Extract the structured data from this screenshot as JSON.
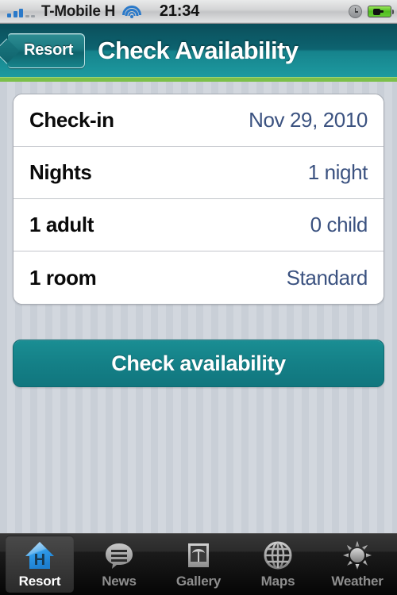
{
  "statusbar": {
    "carrier": "T-Mobile H",
    "time": "21:34",
    "signal_icon": "signal-bars-icon",
    "wifi_icon": "wifi-icon",
    "alarm_icon": "alarm-clock-icon",
    "battery_icon": "battery-charging-icon",
    "signal_bars_filled": 3,
    "signal_bars_total": 5
  },
  "navbar": {
    "back_label": "Resort",
    "title": "Check Availability",
    "accent_color": "#7cbf4a",
    "background_color": "#0d6370"
  },
  "form": {
    "rows": [
      {
        "label": "Check-in",
        "value": "Nov 29, 2010"
      },
      {
        "label": "Nights",
        "value": "1 night"
      },
      {
        "label": "1 adult",
        "value": "0 child"
      },
      {
        "label": "1 room",
        "value": "Standard"
      }
    ]
  },
  "action": {
    "check_label": "Check availability",
    "color": "#148087"
  },
  "tabbar": {
    "tabs": [
      {
        "label": "Resort",
        "icon": "house-icon",
        "active": true
      },
      {
        "label": "News",
        "icon": "speech-bubble-icon",
        "active": false
      },
      {
        "label": "Gallery",
        "icon": "photo-palm-icon",
        "active": false
      },
      {
        "label": "Maps",
        "icon": "globe-icon",
        "active": false
      },
      {
        "label": "Weather",
        "icon": "sun-icon",
        "active": false
      }
    ]
  }
}
